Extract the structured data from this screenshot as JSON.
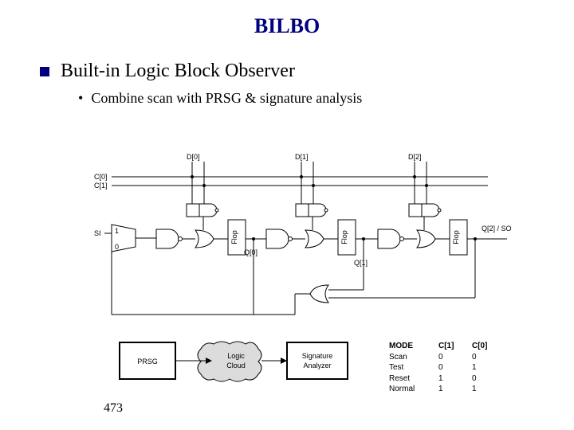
{
  "title": "BILBO",
  "bullet_main": "Built-in Logic Block Observer",
  "bullet_sub": "Combine scan with PRSG & signature analysis",
  "labels": {
    "d0": "D[0]",
    "d1": "D[1]",
    "d2": "D[2]",
    "c0": "C[0]",
    "c1": "C[1]",
    "si": "SI",
    "one": "1",
    "zero": "0",
    "flop": "Flop",
    "q0": "Q[0]",
    "q1": "Q[1]",
    "q2so": "Q[2] / SO"
  },
  "blocks": {
    "prsg": "PRSG",
    "logic_cloud_l1": "Logic",
    "logic_cloud_l2": "Cloud",
    "sig_l1": "Signature",
    "sig_l2": "Analyzer"
  },
  "table": {
    "header": {
      "mode": "MODE",
      "c1": "C[1]",
      "c0": "C[0]"
    },
    "rows": [
      {
        "mode": "Scan",
        "c1": "0",
        "c0": "0"
      },
      {
        "mode": "Test",
        "c1": "0",
        "c0": "1"
      },
      {
        "mode": "Reset",
        "c1": "1",
        "c0": "0"
      },
      {
        "mode": "Normal",
        "c1": "1",
        "c0": "1"
      }
    ]
  },
  "page": "473"
}
